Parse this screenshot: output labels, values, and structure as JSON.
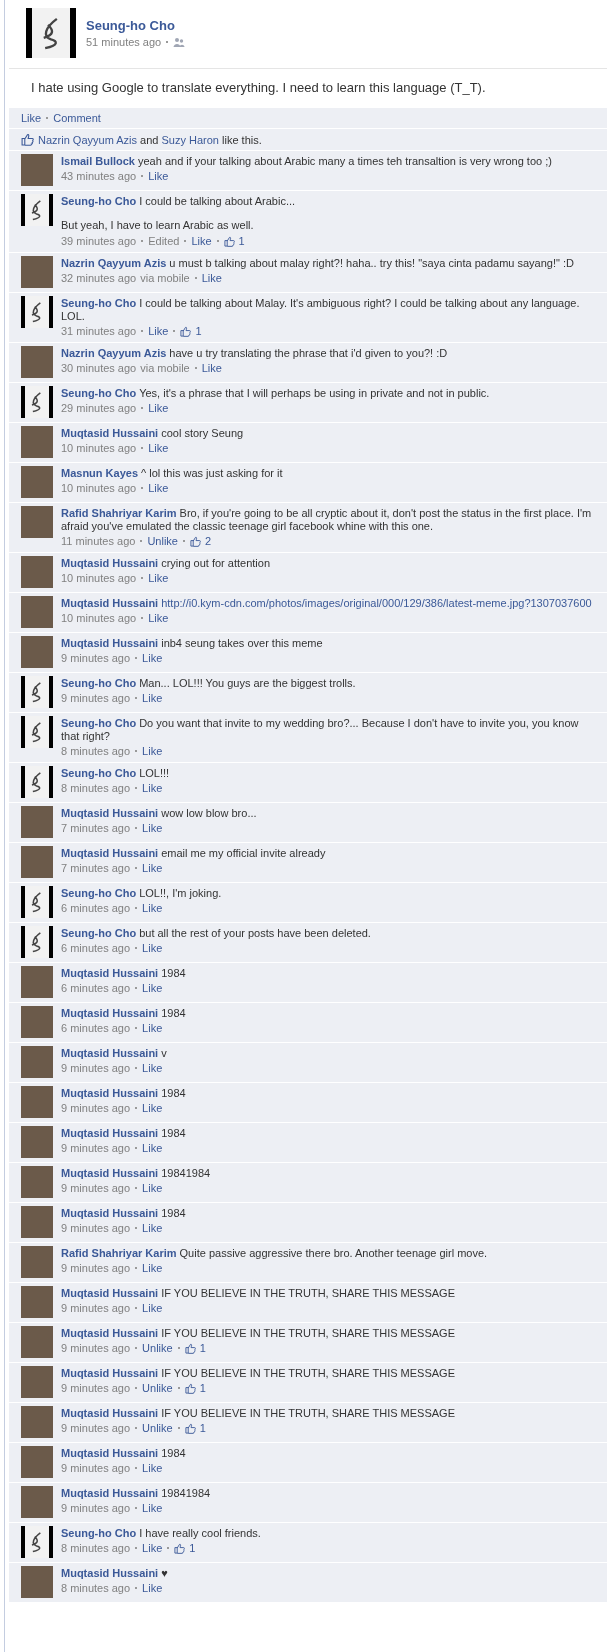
{
  "post": {
    "author": "Seung-ho Cho",
    "time": "51 minutes ago",
    "text": "I hate using Google to translate everything. I need to learn this language (T_T).",
    "actions": [
      "Like",
      "Comment"
    ],
    "likers": [
      "Nazrin Qayyum Azis",
      "Suzy Haron"
    ],
    "likers_joiner": "and",
    "likers_suffix": "like this."
  },
  "comments": [
    {
      "kind": "photo",
      "author": "Ismail Bullock",
      "text": "yeah and if your talking about Arabic many a times teh transaltion is very wrong too ;)",
      "time": "43 minutes ago",
      "action": "Like"
    },
    {
      "kind": "calligraphy",
      "author": "Seung-ho Cho",
      "text": "I could be talking about Arabic...",
      "more": "But yeah, I have to learn Arabic as well.",
      "time": "39 minutes ago",
      "edited": "Edited",
      "action": "Like",
      "likes": "1"
    },
    {
      "kind": "photo",
      "author": "Nazrin Qayyum Azis",
      "text": "u must b talking about malay right?! haha.. try this! \"saya cinta padamu sayang!\" :D",
      "time": "32 minutes ago",
      "via": "via mobile",
      "action": "Like"
    },
    {
      "kind": "calligraphy",
      "author": "Seung-ho Cho",
      "text": "I could be talking about Malay. It's ambiguous right? I could be talking about any language. LOL.",
      "time": "31 minutes ago",
      "action": "Like",
      "likes": "1"
    },
    {
      "kind": "photo",
      "author": "Nazrin Qayyum Azis",
      "text": "have u try translating the phrase that i'd given to you?! :D",
      "time": "30 minutes ago",
      "via": "via mobile",
      "action": "Like"
    },
    {
      "kind": "calligraphy",
      "author": "Seung-ho Cho",
      "text": "Yes, it's a phrase that I will perhaps be using in private and not in public.",
      "time": "29 minutes ago",
      "action": "Like"
    },
    {
      "kind": "photo",
      "author": "Muqtasid Hussaini",
      "text": "cool story Seung",
      "time": "10 minutes ago",
      "action": "Like"
    },
    {
      "kind": "photo",
      "author": "Masnun Kayes",
      "text": "^ lol this was just asking for it",
      "time": "10 minutes ago",
      "action": "Like"
    },
    {
      "kind": "photo",
      "author": "Rafid Shahriyar Karim",
      "text": "Bro, if you're going to be all cryptic about it, don't post the status in the first place. I'm afraid you've emulated the classic teenage girl facebook whine with this one.",
      "time": "11 minutes ago",
      "action": "Unlike",
      "likes": "2"
    },
    {
      "kind": "photo",
      "author": "Muqtasid Hussaini",
      "text": "crying out for attention",
      "time": "10 minutes ago",
      "action": "Like"
    },
    {
      "kind": "photo",
      "author": "Muqtasid Hussaini",
      "url": "http://i0.kym-cdn.com/photos/images/original/000/129/386/latest-meme.jpg?1307037600",
      "time": "10 minutes ago",
      "action": "Like"
    },
    {
      "kind": "photo",
      "author": "Muqtasid Hussaini",
      "text": "inb4 seung takes over this meme",
      "time": "9 minutes ago",
      "action": "Like"
    },
    {
      "kind": "calligraphy",
      "author": "Seung-ho Cho",
      "text": "Man... LOL!!! You guys are the biggest trolls.",
      "time": "9 minutes ago",
      "action": "Like"
    },
    {
      "kind": "calligraphy",
      "author": "Seung-ho Cho",
      "text": "Do you want that invite to my wedding bro?... Because I don't have to invite you, you know that right?",
      "time": "8 minutes ago",
      "action": "Like"
    },
    {
      "kind": "calligraphy",
      "author": "Seung-ho Cho",
      "text": "LOL!!!",
      "time": "8 minutes ago",
      "action": "Like"
    },
    {
      "kind": "photo",
      "author": "Muqtasid Hussaini",
      "text": "wow low blow bro...",
      "time": "7 minutes ago",
      "action": "Like"
    },
    {
      "kind": "photo",
      "author": "Muqtasid Hussaini",
      "text": "email me my official invite already",
      "time": "7 minutes ago",
      "action": "Like"
    },
    {
      "kind": "calligraphy",
      "author": "Seung-ho Cho",
      "text": "LOL!!, I'm joking.",
      "time": "6 minutes ago",
      "action": "Like"
    },
    {
      "kind": "calligraphy",
      "author": "Seung-ho Cho",
      "text": "but all the rest of your posts have been deleted.",
      "time": "6 minutes ago",
      "action": "Like"
    },
    {
      "kind": "photo",
      "author": "Muqtasid Hussaini",
      "text": "1984",
      "time": "6 minutes ago",
      "action": "Like"
    },
    {
      "kind": "photo",
      "author": "Muqtasid Hussaini",
      "text": "1984",
      "time": "6 minutes ago",
      "action": "Like"
    },
    {
      "kind": "photo",
      "author": "Muqtasid Hussaini",
      "text": "v",
      "time": "9 minutes ago",
      "action": "Like"
    },
    {
      "kind": "photo",
      "author": "Muqtasid Hussaini",
      "text": "1984",
      "time": "9 minutes ago",
      "action": "Like"
    },
    {
      "kind": "photo",
      "author": "Muqtasid Hussaini",
      "text": "1984",
      "time": "9 minutes ago",
      "action": "Like"
    },
    {
      "kind": "photo",
      "author": "Muqtasid Hussaini",
      "text": "19841984",
      "time": "9 minutes ago",
      "action": "Like"
    },
    {
      "kind": "photo",
      "author": "Muqtasid Hussaini",
      "text": "1984",
      "time": "9 minutes ago",
      "action": "Like"
    },
    {
      "kind": "photo",
      "author": "Rafid Shahriyar Karim",
      "text": "Quite passive aggressive there bro. Another teenage girl move.",
      "time": "9 minutes ago",
      "action": "Like"
    },
    {
      "kind": "photo",
      "author": "Muqtasid Hussaini",
      "text": "IF YOU BELIEVE IN THE TRUTH, SHARE THIS MESSAGE",
      "time": "9 minutes ago",
      "action": "Like"
    },
    {
      "kind": "photo",
      "author": "Muqtasid Hussaini",
      "text": "IF YOU BELIEVE IN THE TRUTH, SHARE THIS MESSAGE",
      "time": "9 minutes ago",
      "action": "Unlike",
      "likes": "1"
    },
    {
      "kind": "photo",
      "author": "Muqtasid Hussaini",
      "text": "IF YOU BELIEVE IN THE TRUTH, SHARE THIS MESSAGE",
      "time": "9 minutes ago",
      "action": "Unlike",
      "likes": "1"
    },
    {
      "kind": "photo",
      "author": "Muqtasid Hussaini",
      "text": "IF YOU BELIEVE IN THE TRUTH, SHARE THIS MESSAGE",
      "time": "9 minutes ago",
      "action": "Unlike",
      "likes": "1"
    },
    {
      "kind": "photo",
      "author": "Muqtasid Hussaini",
      "text": "1984",
      "time": "9 minutes ago",
      "action": "Like"
    },
    {
      "kind": "photo",
      "author": "Muqtasid Hussaini",
      "text": "19841984",
      "time": "9 minutes ago",
      "action": "Like"
    },
    {
      "kind": "calligraphy",
      "author": "Seung-ho Cho",
      "text": "I have really cool friends.",
      "time": "8 minutes ago",
      "action": "Like",
      "likes": "1"
    },
    {
      "kind": "photo",
      "author": "Muqtasid Hussaini",
      "text": "♥",
      "time": "8 minutes ago",
      "action": "Like"
    }
  ]
}
